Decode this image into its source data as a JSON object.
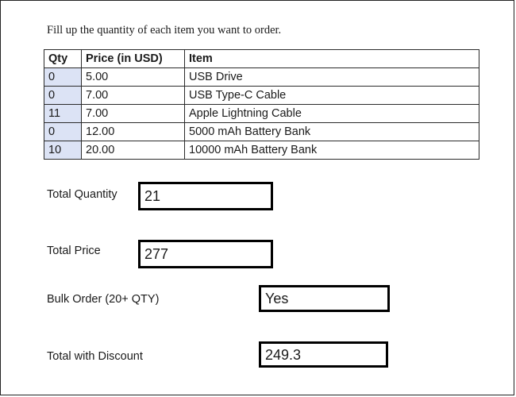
{
  "instruction": "Fill up the quantity of each item you want to order.",
  "table": {
    "columns": [
      "Qty",
      "Price (in USD)",
      "Item"
    ],
    "rows": [
      {
        "qty": "0",
        "price": "5.00",
        "item": "USB Drive"
      },
      {
        "qty": "0",
        "price": "7.00",
        "item": "USB Type-C Cable"
      },
      {
        "qty": "11",
        "price": "7.00",
        "item": "Apple Lightning Cable"
      },
      {
        "qty": "0",
        "price": "12.00",
        "item": "5000 mAh Battery Bank"
      },
      {
        "qty": "10",
        "price": "20.00",
        "item": "10000 mAh Battery Bank"
      }
    ],
    "qty_cell_color": "#dce3f5"
  },
  "summary": {
    "total_quantity": {
      "label": "Total Quantity",
      "value": "21"
    },
    "total_price": {
      "label": "Total Price",
      "value": "277"
    },
    "bulk_order": {
      "label": "Bulk Order (20+ QTY)",
      "value": "Yes"
    },
    "total_with_discount": {
      "label": "Total with Discount",
      "value": "249.3"
    }
  }
}
